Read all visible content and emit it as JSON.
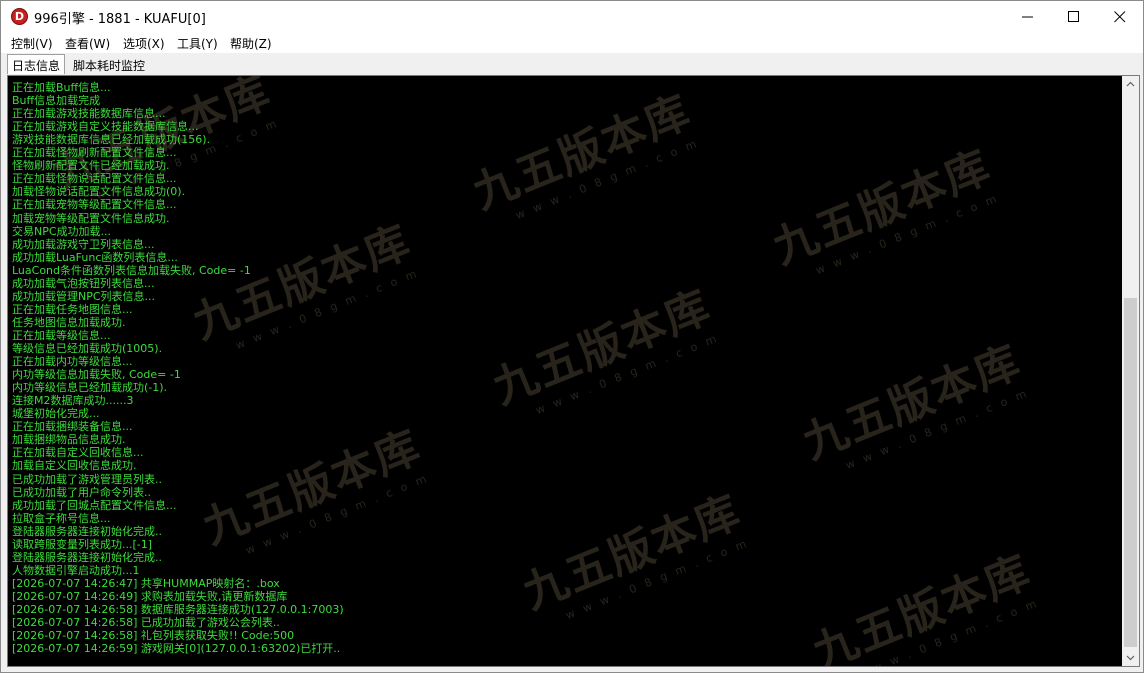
{
  "window": {
    "title": "996引擎 - 1881 - KUAFU[0]",
    "icon_letter": "D",
    "icon": "app-logo-icon"
  },
  "menu": {
    "items": [
      "控制(V)",
      "查看(W)",
      "选项(X)",
      "工具(Y)",
      "帮助(Z)"
    ]
  },
  "tabs": [
    {
      "label": "日志信息",
      "active": true
    },
    {
      "label": "脚本耗时监控",
      "active": false
    }
  ],
  "log": [
    "正在加载Buff信息...",
    "Buff信息加载完成",
    "正在加载游戏技能数据库信息...",
    "正在加载游戏自定义技能数据库信息...",
    "游戏技能数据库信息已经加载成功(156).",
    "正在加载怪物刷新配置文件信息...",
    "怪物刷新配置文件已经加载成功.",
    "正在加载怪物说话配置文件信息...",
    "加载怪物说话配置文件信息成功(0).",
    "正在加载宠物等级配置文件信息...",
    "加载宠物等级配置文件信息成功.",
    "交易NPC成功加载...",
    "成功加载游戏守卫列表信息...",
    "成功加载LuaFunc函数列表信息...",
    "LuaCond条件函数列表信息加载失败, Code= -1",
    "成功加载气泡按钮列表信息...",
    "成功加载管理NPC列表信息...",
    "正在加载任务地图信息...",
    "任务地图信息加载成功.",
    "正在加载等级信息...",
    "等级信息已经加载成功(1005).",
    "正在加载内功等级信息...",
    "内功等级信息加载失败, Code= -1",
    "内功等级信息已经加载成功(-1).",
    "连接M2数据库成功......3",
    "城堡初始化完成...",
    "正在加载捆绑装备信息...",
    "加载捆绑物品信息成功.",
    "正在加载自定义回收信息...",
    "加载自定义回收信息成功.",
    "已成功加载了游戏管理员列表..",
    "已成功加载了用户命令列表..",
    "成功加载了回城点配置文件信息...",
    "拉取盒子称号信息...",
    "登陆器服务器连接初始化完成..",
    "读取跨服变量列表成功...[-1]",
    "登陆器服务器连接初始化完成..",
    "人物数据引擎启动成功...1",
    "[2026-07-07 14:26:47] 共享HUMMAP映射名：.box",
    "[2026-07-07 14:26:49] 求购表加载失败,请更新数据库",
    "[2026-07-07 14:26:58] 数据库服务器连接成功(127.0.0.1:7003)",
    "[2026-07-07 14:26:58] 已成功加载了游戏公会列表..",
    "[2026-07-07 14:26:58] 礼包列表获取失败!! Code:500",
    "[2026-07-07 14:26:59] 游戏网关[0](127.0.0.1:63202)已打开.."
  ],
  "watermark": {
    "main": "九五版本库",
    "sub": "w w w . 0 8 g m . c o m"
  },
  "colors": {
    "log_text": "#3ddc3d",
    "console_bg": "#000000",
    "app_icon": "#c62020"
  }
}
